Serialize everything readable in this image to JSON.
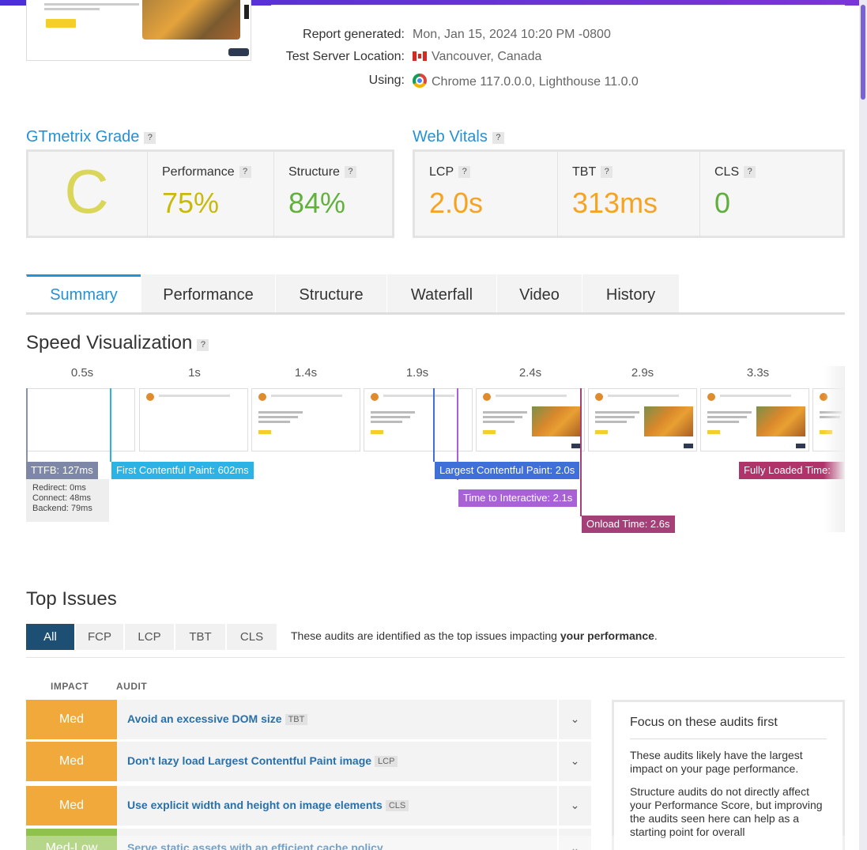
{
  "report": {
    "generated_label": "Report generated:",
    "generated_value": "Mon, Jan 15, 2024 10:20 PM -0800",
    "location_label": "Test Server Location:",
    "location_value": "Vancouver, Canada",
    "using_label": "Using:",
    "using_value": "Chrome 117.0.0.0, Lighthouse 11.0.0"
  },
  "grade": {
    "title": "GTmetrix Grade",
    "help": "?",
    "letter": "C",
    "performance_label": "Performance",
    "performance_value": "75%",
    "structure_label": "Structure",
    "structure_value": "84%"
  },
  "vitals": {
    "title": "Web Vitals",
    "help": "?",
    "lcp_label": "LCP",
    "lcp_value": "2.0s",
    "tbt_label": "TBT",
    "tbt_value": "313ms",
    "cls_label": "CLS",
    "cls_value": "0"
  },
  "colors": {
    "link_blue": "#2591d6",
    "grade_c": "#d9d65a",
    "perf": "#c9b90d",
    "structure": "#62b13c",
    "orange": "#f6a323",
    "green": "#5fb03b",
    "med": "#f2a93b",
    "medlow": "#8fc24c"
  },
  "tabs": [
    "Summary",
    "Performance",
    "Structure",
    "Waterfall",
    "Video",
    "History"
  ],
  "speed": {
    "title": "Speed Visualization",
    "help": "?",
    "times": [
      "0.5s",
      "1s",
      "1.4s",
      "1.9s",
      "2.4s",
      "2.9s",
      "3.3s"
    ],
    "ttfb": "TTFB: 127ms",
    "ttfb_details": [
      "Redirect: 0ms",
      "Connect: 48ms",
      "Backend: 79ms"
    ],
    "fcp": "First Contentful Paint: 602ms",
    "lcp": "Largest Contentful Paint: 2.0s",
    "tti": "Time to Interactive: 2.1s",
    "onload": "Onload Time: 2.6s",
    "fully_loaded": "Fully Loaded Time:"
  },
  "issues": {
    "title": "Top Issues",
    "filters": [
      "All",
      "FCP",
      "LCP",
      "TBT",
      "CLS"
    ],
    "note_prefix": "These audits are identified as the top issues impacting ",
    "note_bold": "your performance",
    "note_suffix": ".",
    "col_impact": "IMPACT",
    "col_audit": "AUDIT",
    "rows": [
      {
        "impact": "Med",
        "audit": "Avoid an excessive DOM size",
        "tag": "TBT"
      },
      {
        "impact": "Med",
        "audit": "Don't lazy load Largest Contentful Paint image",
        "tag": "LCP"
      },
      {
        "impact": "Med",
        "audit": "Use explicit width and height on image elements",
        "tag": "CLS"
      },
      {
        "impact": "Med-Low",
        "audit": "Serve static assets with an efficient cache policy",
        "tag": ""
      }
    ],
    "focus_title": "Focus on these audits first",
    "focus_p1": "These audits likely have the largest impact on your page performance.",
    "focus_p2": "Structure audits do not directly affect your Performance Score, but improving the audits seen here can help as a starting point for overall"
  }
}
